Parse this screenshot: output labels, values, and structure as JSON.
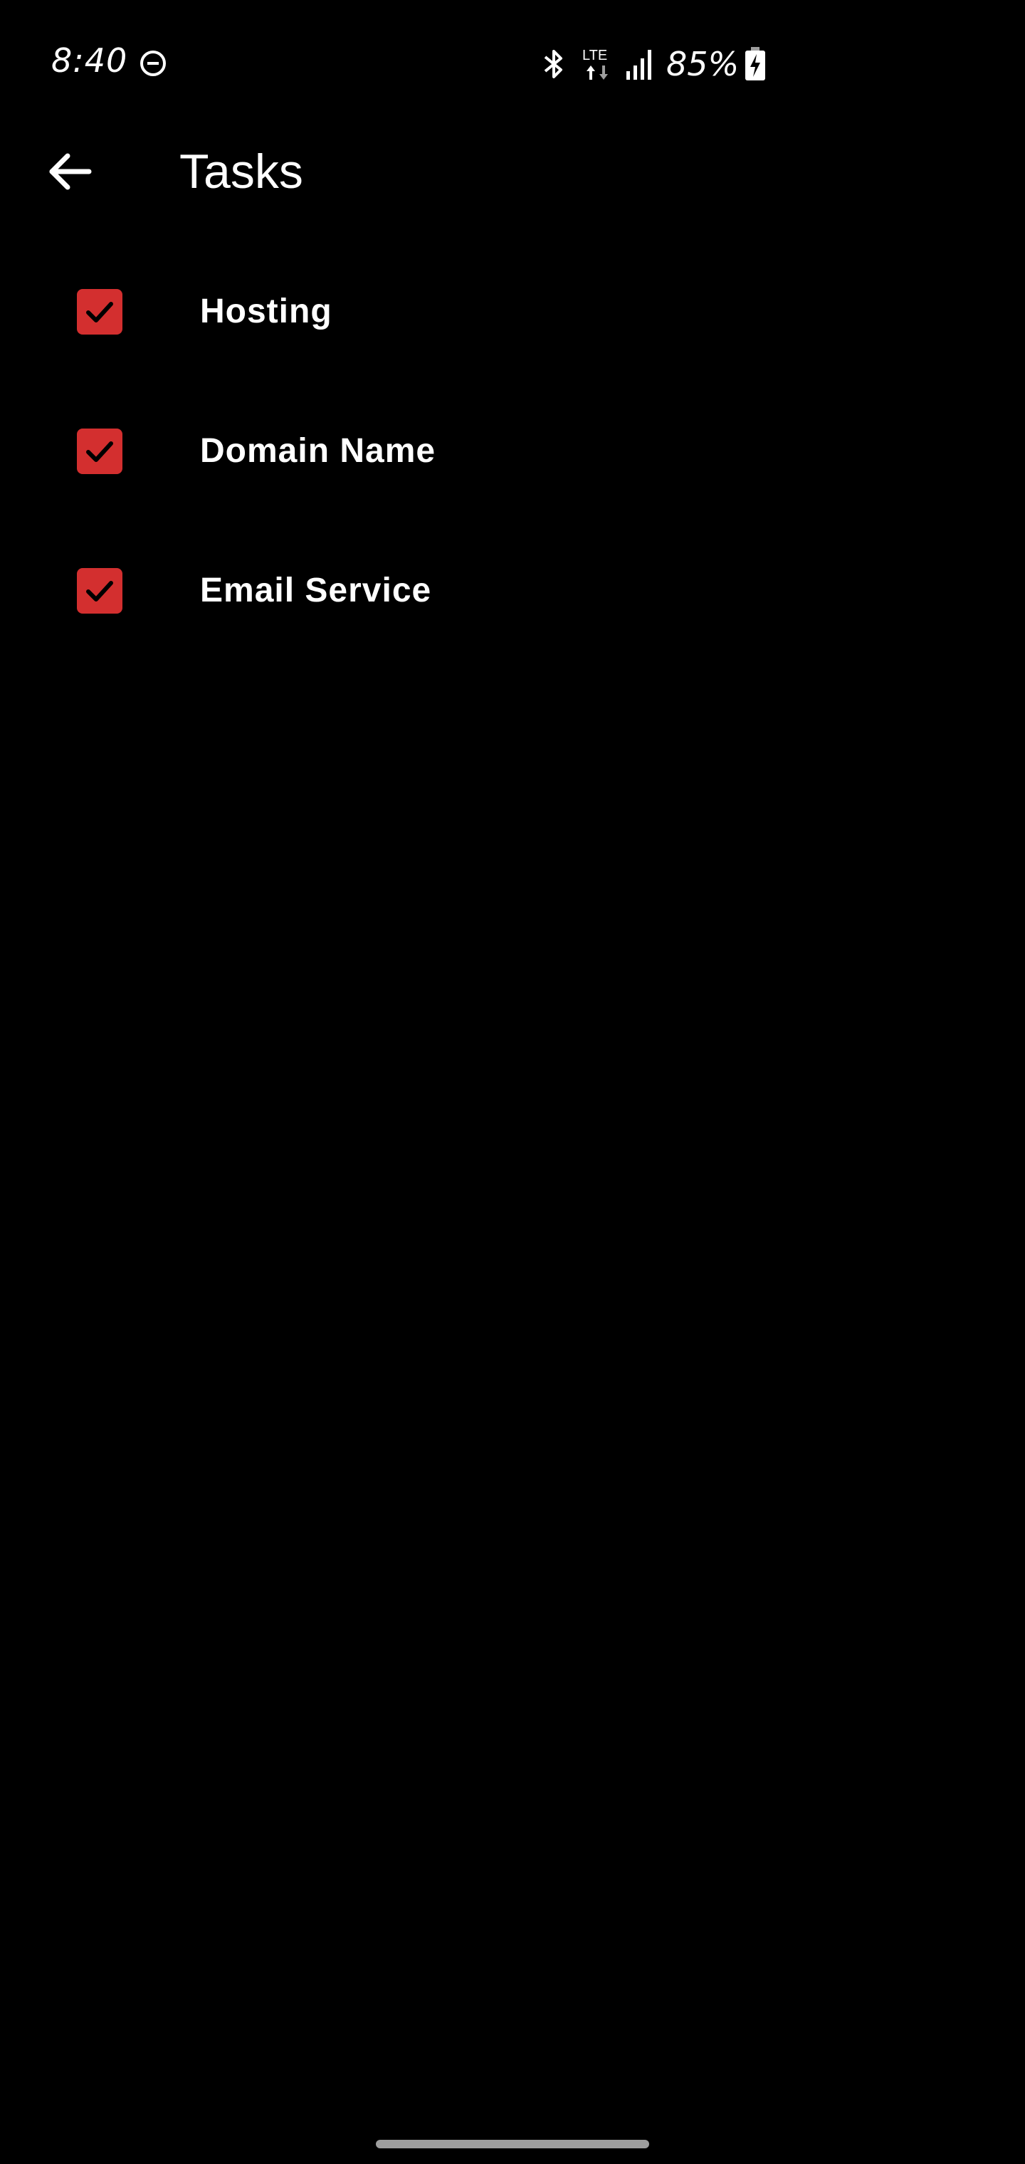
{
  "status_bar": {
    "time": "8:40",
    "network": "LTE",
    "battery": "85%",
    "icons": [
      "do-not-disturb-icon",
      "bluetooth-icon",
      "lte-icon",
      "signal-icon",
      "battery-charging-icon"
    ]
  },
  "app_bar": {
    "back_icon": "arrow-back-icon",
    "title": "Tasks"
  },
  "tasks": [
    {
      "label": "Hosting",
      "checked": true
    },
    {
      "label": "Domain Name",
      "checked": true
    },
    {
      "label": "Email Service",
      "checked": true
    }
  ],
  "colors": {
    "background": "#000000",
    "accent": "#d32f2f",
    "text": "#ffffff"
  }
}
